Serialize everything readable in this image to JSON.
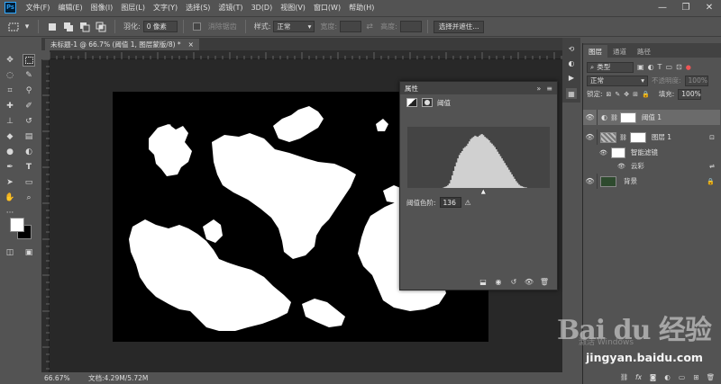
{
  "app": {
    "logo_text": "Ps"
  },
  "menu": [
    "文件(F)",
    "编辑(E)",
    "图像(I)",
    "图层(L)",
    "文字(Y)",
    "选择(S)",
    "滤镜(T)",
    "3D(D)",
    "视图(V)",
    "窗口(W)",
    "帮助(H)"
  ],
  "window_controls": {
    "minimize": "—",
    "restore": "❐",
    "close": "✕"
  },
  "options": {
    "feather_label": "羽化:",
    "feather_value": "0 像素",
    "antialias_label": "消除锯齿",
    "style_label": "样式:",
    "style_value": "正常",
    "width_label": "宽度:",
    "height_label": "高度:",
    "select_mask_button": "选择并遮住..."
  },
  "document": {
    "tab_title": "未标题-1 @ 66.7% (阈值 1, 图层蒙版/8) *",
    "close_glyph": "×"
  },
  "status": {
    "zoom": "66.67%",
    "doc_info": "文档:4.29M/5.72M"
  },
  "properties": {
    "panel_title": "属性",
    "adjustment_name": "阈值",
    "threshold_label": "阈值色阶:",
    "threshold_value": "136",
    "collapse_glyph": "»",
    "menu_glyph": "≡"
  },
  "histogram": {
    "description_values": [
      0,
      0,
      0,
      0,
      0,
      0,
      0,
      0,
      0,
      0,
      0,
      0,
      0,
      0,
      0,
      0,
      0,
      0,
      0,
      0,
      0,
      0,
      0,
      0,
      0,
      1,
      2,
      3,
      5,
      8,
      14,
      22,
      30,
      38,
      45,
      52,
      58,
      62,
      65,
      70,
      72,
      74,
      78,
      82,
      86,
      88,
      90,
      92,
      91,
      90,
      92,
      94,
      95,
      93,
      90,
      88,
      86,
      84,
      80,
      78,
      75,
      72,
      68,
      64,
      60,
      56,
      52,
      48,
      44,
      40,
      36,
      32,
      28,
      24,
      20,
      16,
      12,
      9,
      6,
      4,
      3,
      2,
      1,
      1,
      0,
      0,
      0,
      0,
      0,
      0,
      0,
      0,
      0,
      0,
      0,
      0,
      0,
      0,
      0,
      0
    ],
    "threshold_level": 136
  },
  "layers_panel": {
    "tabs": [
      "图层",
      "通道",
      "路径"
    ],
    "filter_label": "类型",
    "blend_mode": "正常",
    "opacity_label": "不透明度:",
    "opacity_value": "100%",
    "lock_label": "锁定:",
    "fill_label": "填充:",
    "fill_value": "100%",
    "layers": [
      {
        "name": "阈值 1",
        "selected": true
      },
      {
        "name": "图层 1",
        "selected": false
      },
      {
        "name": "智能滤镜",
        "selected": false
      },
      {
        "name": "云彩",
        "selected": false
      },
      {
        "name": "背景",
        "selected": false
      }
    ]
  },
  "watermark": {
    "logo": "Bai du 经验",
    "url": "jingyan.baidu.com",
    "activate": "激活 Windows"
  },
  "colors": {
    "panel_bg": "#535353",
    "workspace_bg": "#282828",
    "canvas_bg": "#000000",
    "accent_blue": "#31a8ff",
    "background_layer_thumb": "#2e4a2e"
  }
}
